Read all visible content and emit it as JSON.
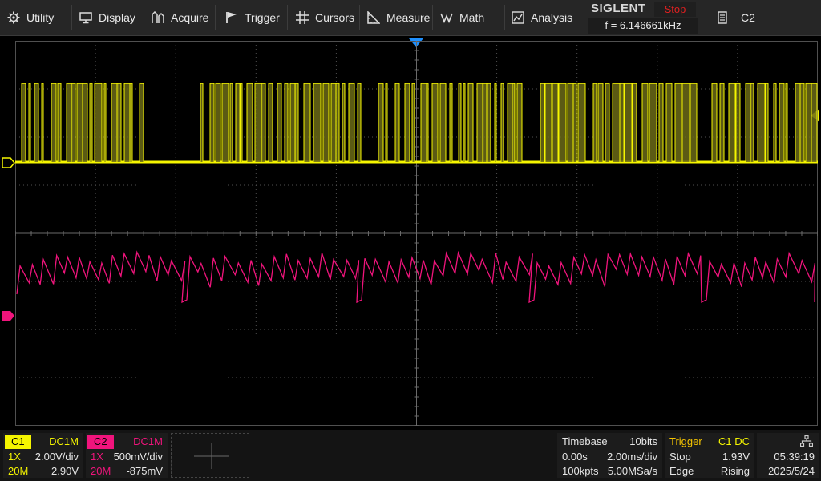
{
  "menu": {
    "items": [
      {
        "label": "Utility",
        "icon": "gear-icon"
      },
      {
        "label": "Display",
        "icon": "monitor-icon"
      },
      {
        "label": "Acquire",
        "icon": "acquire-icon"
      },
      {
        "label": "Trigger",
        "icon": "flag-icon"
      },
      {
        "label": "Cursors",
        "icon": "cursor-cross-icon"
      },
      {
        "label": "Measure",
        "icon": "ruler-icon"
      },
      {
        "label": "Math",
        "icon": "math-icon"
      },
      {
        "label": "Analysis",
        "icon": "analysis-icon"
      }
    ]
  },
  "brand": {
    "name": "SIGLENT",
    "run_state": "Stop",
    "frequency": "f = 6.146661kHz"
  },
  "channel_select": {
    "label": "C2",
    "icon": "document-icon"
  },
  "colors": {
    "ch1": "#f5f500",
    "ch2": "#f0147c",
    "trigger_marker": "#1e90ff",
    "grid": "#505050"
  },
  "ch1": {
    "name": "C1",
    "coupling": "DC1M",
    "probe": "1X",
    "scale": "2.00V/div",
    "bandwidth": "20M",
    "offset": "2.90V"
  },
  "ch2": {
    "name": "C2",
    "coupling": "DC1M",
    "probe": "1X",
    "scale": "500mV/div",
    "bandwidth": "20M",
    "offset": "-875mV"
  },
  "timebase": {
    "title": "Timebase",
    "bits": "10bits",
    "delay": "0.00s",
    "scale": "2.00ms/div",
    "points": "100kpts",
    "sample_rate": "5.00MSa/s"
  },
  "trigger": {
    "title": "Trigger",
    "source": "C1 DC",
    "state": "Stop",
    "level": "1.93V",
    "type": "Edge",
    "slope": "Rising"
  },
  "clock": {
    "time": "05:39:19",
    "date": "2025/5/24",
    "icon": "network-icon"
  }
}
